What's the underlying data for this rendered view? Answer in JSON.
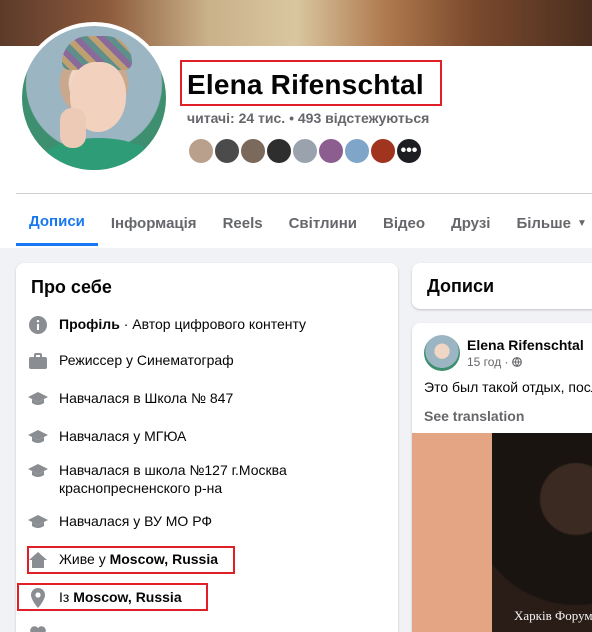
{
  "profile": {
    "name": "Elena Rifenschtal",
    "followers_text": "читачі: 24 тис. • 493 відстежуються",
    "friends_more_label": "•••"
  },
  "tabs": [
    {
      "label": "Дописи",
      "active": true
    },
    {
      "label": "Інформація"
    },
    {
      "label": "Reels"
    },
    {
      "label": "Світлини"
    },
    {
      "label": "Відео"
    },
    {
      "label": "Друзі"
    },
    {
      "label": "Більше"
    }
  ],
  "about": {
    "title": "Про себе",
    "items": [
      {
        "icon": "info-icon",
        "bold": "Профіль",
        "text": " · Автор цифрового контенту"
      },
      {
        "icon": "briefcase-icon",
        "text": "Режиссер у Синематограф"
      },
      {
        "icon": "graduation-cap-icon",
        "text": "Навчалася в Школа № 847"
      },
      {
        "icon": "graduation-cap-icon",
        "text": "Навчалася у МГЮА"
      },
      {
        "icon": "graduation-cap-icon",
        "text": "Навчалася в школа №127 г.Москва краснопресненского р-на"
      },
      {
        "icon": "graduation-cap-icon",
        "text": "Навчалася у ВУ МО РФ"
      },
      {
        "icon": "home-icon",
        "prefix": "Живе у ",
        "bold": "Moscow, Russia"
      },
      {
        "icon": "location-pin-icon",
        "prefix": "Із ",
        "bold": "Moscow, Russia"
      }
    ]
  },
  "posts": {
    "title": "Дописи",
    "post": {
      "author": "Elena Rifenschtal",
      "time": "15 год",
      "text": "Это был такой отдых, после",
      "see_translation": "See translation",
      "watermark": "Харків Форум"
    }
  },
  "colors": {
    "accent": "#1877f2",
    "highlight": "#e01f27",
    "secondary_text": "#65676b"
  }
}
